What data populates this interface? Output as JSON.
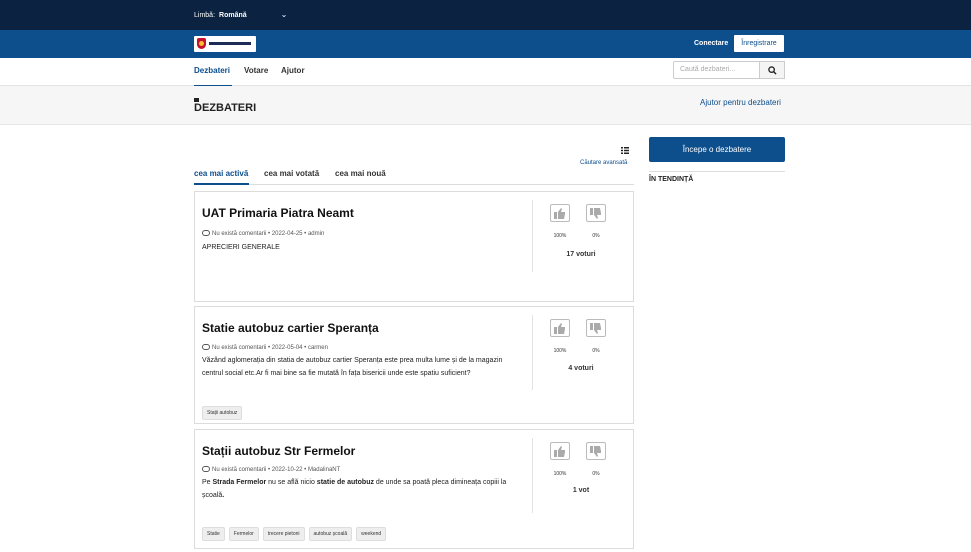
{
  "topbar": {
    "lang_label": "Limbă:",
    "lang_value": "Română"
  },
  "header": {
    "login": "Conectare",
    "register": "Înregistrare"
  },
  "nav": {
    "items": [
      "Dezbateri",
      "Votare",
      "Ajutor"
    ],
    "search_placeholder": "Caută dezbateri..."
  },
  "band": {
    "title": "DEZBATERI",
    "help": "Ajutor pentru dezbateri"
  },
  "filters": {
    "advanced": "Căutare avansată",
    "tabs": [
      "cea mai activă",
      "cea mai votată",
      "cea mai nouă"
    ]
  },
  "sidebar": {
    "start_button": "Începe o dezbatere",
    "trending": "ÎN TENDINȚĂ"
  },
  "debates": [
    {
      "title": "UAT Primaria Piatra Neamt",
      "comments": "Nu există comentarii",
      "date": "2022-04-25",
      "author": "admin",
      "description": "APRECIERI GENERALE",
      "up_pct": "100%",
      "down_pct": "0%",
      "votes": "17 voturi",
      "tags": []
    },
    {
      "title": "Statie autobuz cartier Speranța",
      "comments": "Nu există comentarii",
      "date": "2022-05-04",
      "author": "carmen",
      "description": "Văzând aglomerația din statia de autobuz cartier Speranța este prea multa lume și de la magazin centrul social etc.Ar fi mai bine sa fie mutată în fața bisericii unde este spatiu suficient?",
      "up_pct": "100%",
      "down_pct": "0%",
      "votes": "4 voturi",
      "tags": [
        "Stații autobuz"
      ]
    },
    {
      "title": "Stații autobuz Str Fermelor",
      "comments": "Nu există comentarii",
      "date": "2022-10-22",
      "author": "MadalinaNT",
      "description_parts": {
        "p1": "Pe ",
        "b1": "Strada Fermelor",
        "p2": " nu se află nicio ",
        "b2": "statie de autobuz",
        "p3": " de unde sa poată pleca dimineața copiii la școală",
        "p4": "."
      },
      "up_pct": "100%",
      "down_pct": "0%",
      "votes": "1 vot",
      "tags": [
        "Statie",
        "Fermelor",
        "trecere pietoni",
        "autobuz școală",
        "weekend"
      ]
    }
  ],
  "colors": {
    "topbar": "#0b2340",
    "header": "#0d4e8d",
    "accent": "#0d4e8d"
  }
}
